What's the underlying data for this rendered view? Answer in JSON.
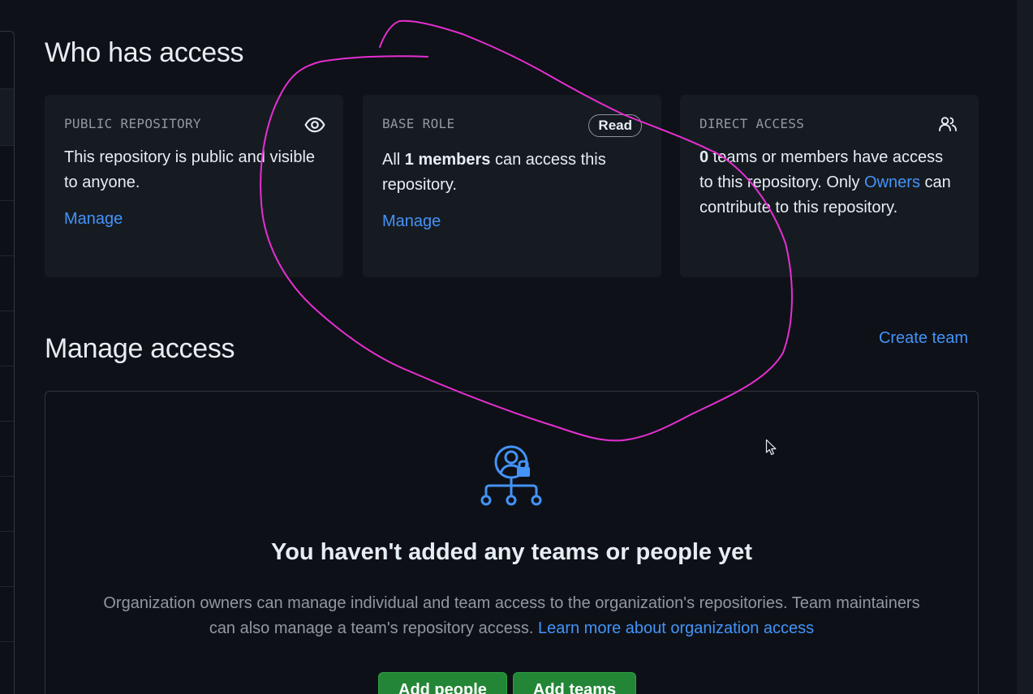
{
  "who_has_access": {
    "title": "Who has access",
    "cards": [
      {
        "label": "PUBLIC REPOSITORY",
        "icon": "eye-icon",
        "body": "This repository is public and visible to anyone.",
        "link": "Manage"
      },
      {
        "label": "BASE ROLE",
        "badge": "Read",
        "body_prefix": "All ",
        "body_bold": "1 members",
        "body_suffix": " can access this repository.",
        "link": "Manage"
      },
      {
        "label": "DIRECT ACCESS",
        "icon": "people-icon",
        "body_bold": "0",
        "body_part1": " teams or members have access to this repository. Only ",
        "body_link": "Owners",
        "body_part2": " can contribute to this repository."
      }
    ]
  },
  "manage_access": {
    "title": "Manage access",
    "create_team": "Create team",
    "empty_state": {
      "icon": "person-lock-team-icon",
      "title": "You haven't added any teams or people yet",
      "description": "Organization owners can manage individual and team access to the organization's repositories. Team maintainers can also manage a team's repository access. ",
      "learn_more": "Learn more about organization access",
      "add_people": "Add people",
      "add_teams": "Add teams"
    }
  },
  "colors": {
    "background": "#0e1117",
    "card": "#161b22",
    "link": "#4493f8",
    "button": "#238636",
    "annotation": "#e62fd1"
  }
}
